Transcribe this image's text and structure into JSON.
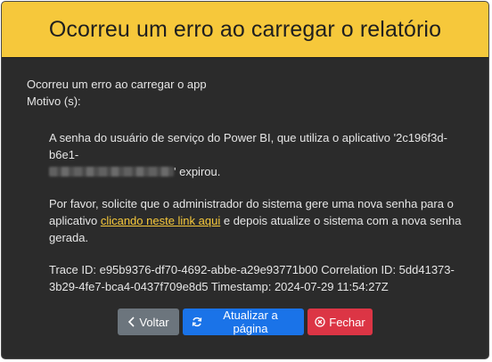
{
  "dialog": {
    "title": "Ocorreu um erro ao carregar o relatório",
    "intro_line1": "Ocorreu um erro ao carregar o app",
    "intro_line2": "Motivo (s):",
    "reason_part1": "A senha do usuário de serviço do Power BI, que utiliza o aplicativo '2c196f3d-b6e1-",
    "reason_part2": "' expirou.",
    "request_part1": "Por favor, solicite que o administrador do sistema gere uma nova senha para o aplicativo ",
    "request_link": "clicando neste link aqui",
    "request_part2": " e depois atualize o sistema com a nova senha gerada.",
    "trace": "Trace ID: e95b9376-df70-4692-abbe-a29e93771b00 Correlation ID: 5dd41373-3b29-4fe7-bca4-0437f709e8d5 Timestamp: 2024-07-29 11:54:27Z"
  },
  "buttons": {
    "back_label": "Voltar",
    "refresh_label": "Atualizar a página",
    "close_label": "Fechar"
  },
  "colors": {
    "header_bg": "#f6c83b",
    "dialog_bg": "#2b2b2b",
    "link": "#f6c83b",
    "back_btn": "#6c757d",
    "refresh_btn": "#1a73e8",
    "close_btn": "#dc3545"
  },
  "icons": {
    "back": "chevron-left-icon",
    "refresh": "refresh-icon",
    "close": "close-circle-icon"
  }
}
